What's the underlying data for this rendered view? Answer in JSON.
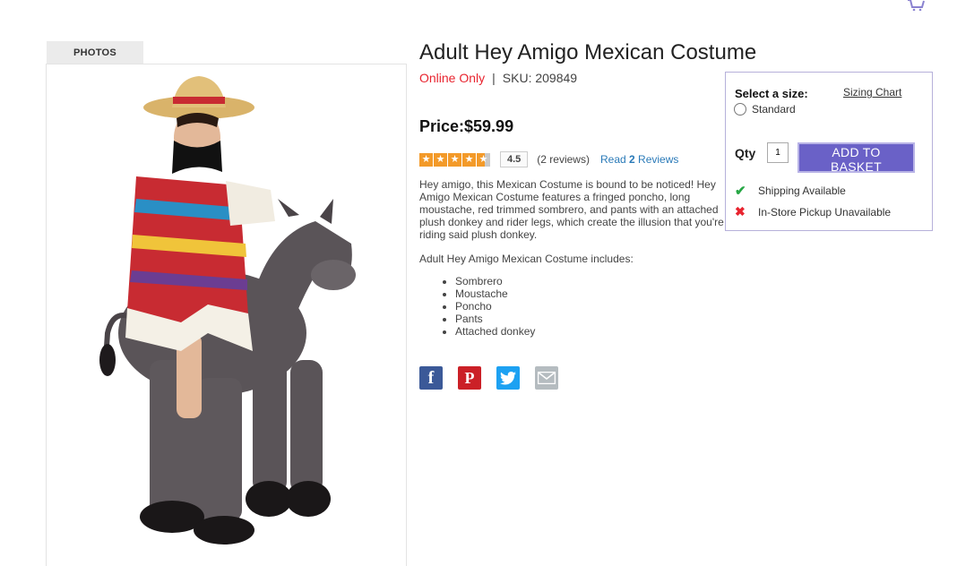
{
  "header": {
    "cart_icon": "shopping-cart-icon"
  },
  "photos": {
    "tab_label": "PHOTOS"
  },
  "product": {
    "title": "Adult Hey Amigo Mexican Costume",
    "availability": "Online Only",
    "separator": "|",
    "sku": "SKU: 209849",
    "price": "Price:$59.99",
    "rating": {
      "stars_value": 4.5,
      "value_label": "4.5",
      "reviews_count": "(2 reviews)",
      "read_prefix": "Read",
      "read_number": "2",
      "read_suffix": "Reviews"
    },
    "description": "Hey amigo, this Mexican Costume is bound to be noticed! Hey Amigo Mexican Costume features a fringed poncho, long moustache, red trimmed sombrero, and pants with an attached plush donkey and rider legs, which create the illusion that you're riding said plush donkey.",
    "includes_heading": "Adult Hey Amigo Mexican Costume includes:",
    "includes": [
      "Sombrero",
      "Moustache",
      "Poncho",
      "Pants",
      "Attached donkey"
    ]
  },
  "social": {
    "facebook_glyph": "f",
    "pinterest_glyph": "P",
    "icons": [
      "facebook-icon",
      "pinterest-icon",
      "twitter-icon",
      "email-icon"
    ]
  },
  "purchase": {
    "size_label": "Select a size:",
    "sizing_chart": "Sizing Chart",
    "size_option": "Standard",
    "qty_label": "Qty",
    "qty_value": "1",
    "add_button": "ADD TO BASKET",
    "shipping": "Shipping Available",
    "pickup": "In-Store Pickup Unavailable"
  },
  "colors": {
    "accent": "#6a61c7",
    "online_red": "#e8242f",
    "link_blue": "#2a7ab8",
    "star_orange": "#f39a29",
    "available_green": "#27a745"
  }
}
